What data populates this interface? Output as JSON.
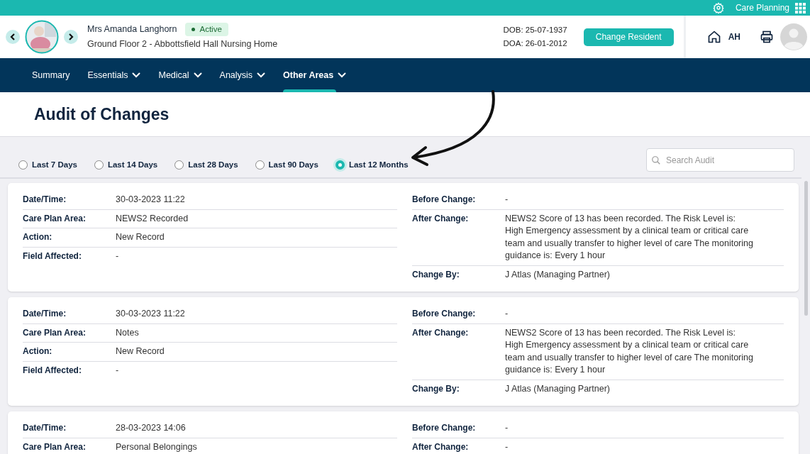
{
  "top_bar": {
    "app_name": "Care Planning"
  },
  "resident": {
    "name": "Mrs Amanda Langhorn",
    "status": "Active",
    "location": "Ground Floor 2 - Abbottsfield Hall Nursing Home",
    "dob": "DOB: 25-07-1937",
    "doa": "DOA: 26-01-2012",
    "change_button": "Change Resident",
    "user_initials": "AH"
  },
  "nav": [
    {
      "label": "Summary",
      "dropdown": false,
      "selected": false
    },
    {
      "label": "Essentials",
      "dropdown": true,
      "selected": false
    },
    {
      "label": "Medical",
      "dropdown": true,
      "selected": false
    },
    {
      "label": "Analysis",
      "dropdown": true,
      "selected": false
    },
    {
      "label": "Other Areas",
      "dropdown": true,
      "selected": true
    }
  ],
  "page_title": "Audit of Changes",
  "ranges": [
    {
      "label": "Last 7 Days",
      "selected": false
    },
    {
      "label": "Last 14 Days",
      "selected": false
    },
    {
      "label": "Last 28 Days",
      "selected": false
    },
    {
      "label": "Last 90 Days",
      "selected": false
    },
    {
      "label": "Last 12 Months",
      "selected": true
    }
  ],
  "search": {
    "placeholder": "Search Audit"
  },
  "records": [
    {
      "left": [
        {
          "label": "Date/Time:",
          "value": "30-03-2023 11:22"
        },
        {
          "label": "Care Plan Area:",
          "value": "NEWS2 Recorded"
        },
        {
          "label": "Action:",
          "value": "New Record"
        },
        {
          "label": "Field Affected:",
          "value": "-"
        }
      ],
      "right": [
        {
          "label": "Before Change:",
          "value": "-"
        },
        {
          "label": "After Change:",
          "value": "NEWS2 Score of 13 has been recorded. The Risk Level is: High Emergency assessment by a clinical team or critical care team and usually transfer to higher level of care The monitoring guidance is: Every 1 hour"
        },
        {
          "label": "Change By:",
          "value": "J Atlas (Managing Partner)"
        }
      ]
    },
    {
      "left": [
        {
          "label": "Date/Time:",
          "value": "30-03-2023 11:22"
        },
        {
          "label": "Care Plan Area:",
          "value": "Notes"
        },
        {
          "label": "Action:",
          "value": "New Record"
        },
        {
          "label": "Field Affected:",
          "value": "-"
        }
      ],
      "right": [
        {
          "label": "Before Change:",
          "value": "-"
        },
        {
          "label": "After Change:",
          "value": "NEWS2 Score of 13 has been recorded. The Risk Level is: High Emergency assessment by a clinical team or critical care team and usually transfer to higher level of care The monitoring guidance is: Every 1 hour"
        },
        {
          "label": "Change By:",
          "value": "J Atlas (Managing Partner)"
        }
      ]
    },
    {
      "left": [
        {
          "label": "Date/Time:",
          "value": "28-03-2023 14:06"
        },
        {
          "label": "Care Plan Area:",
          "value": "Personal Belongings"
        }
      ],
      "right": [
        {
          "label": "Before Change:",
          "value": "-"
        },
        {
          "label": "After Change:",
          "value": "-"
        }
      ]
    }
  ]
}
